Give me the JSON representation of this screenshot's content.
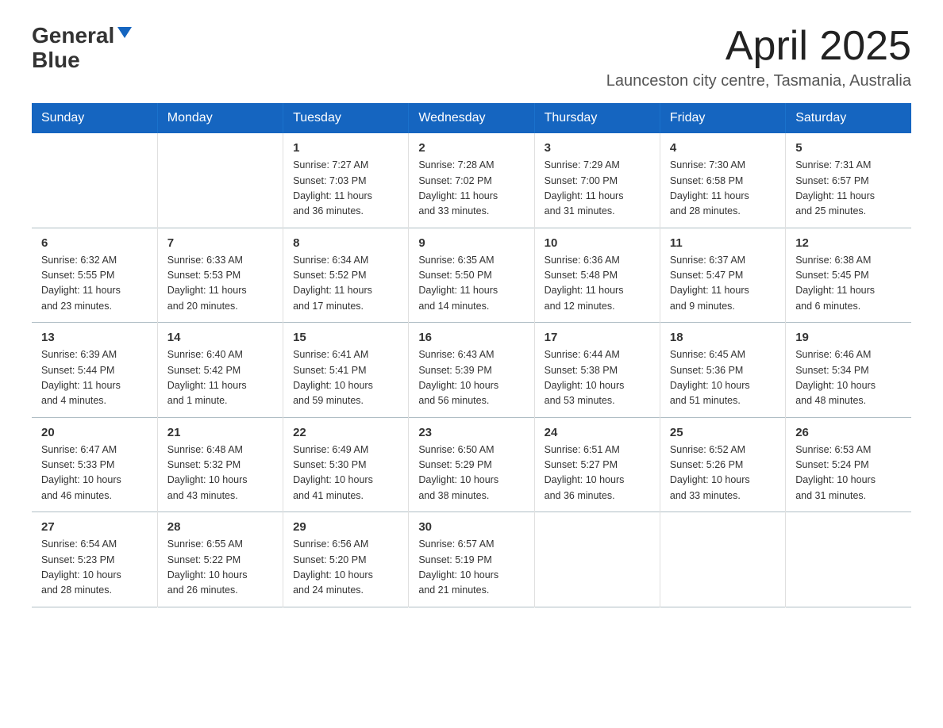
{
  "header": {
    "logo_line1": "General",
    "logo_line2": "Blue",
    "month_title": "April 2025",
    "location": "Launceston city centre, Tasmania, Australia"
  },
  "weekdays": [
    "Sunday",
    "Monday",
    "Tuesday",
    "Wednesday",
    "Thursday",
    "Friday",
    "Saturday"
  ],
  "weeks": [
    [
      {
        "day": "",
        "info": ""
      },
      {
        "day": "",
        "info": ""
      },
      {
        "day": "1",
        "info": "Sunrise: 7:27 AM\nSunset: 7:03 PM\nDaylight: 11 hours\nand 36 minutes."
      },
      {
        "day": "2",
        "info": "Sunrise: 7:28 AM\nSunset: 7:02 PM\nDaylight: 11 hours\nand 33 minutes."
      },
      {
        "day": "3",
        "info": "Sunrise: 7:29 AM\nSunset: 7:00 PM\nDaylight: 11 hours\nand 31 minutes."
      },
      {
        "day": "4",
        "info": "Sunrise: 7:30 AM\nSunset: 6:58 PM\nDaylight: 11 hours\nand 28 minutes."
      },
      {
        "day": "5",
        "info": "Sunrise: 7:31 AM\nSunset: 6:57 PM\nDaylight: 11 hours\nand 25 minutes."
      }
    ],
    [
      {
        "day": "6",
        "info": "Sunrise: 6:32 AM\nSunset: 5:55 PM\nDaylight: 11 hours\nand 23 minutes."
      },
      {
        "day": "7",
        "info": "Sunrise: 6:33 AM\nSunset: 5:53 PM\nDaylight: 11 hours\nand 20 minutes."
      },
      {
        "day": "8",
        "info": "Sunrise: 6:34 AM\nSunset: 5:52 PM\nDaylight: 11 hours\nand 17 minutes."
      },
      {
        "day": "9",
        "info": "Sunrise: 6:35 AM\nSunset: 5:50 PM\nDaylight: 11 hours\nand 14 minutes."
      },
      {
        "day": "10",
        "info": "Sunrise: 6:36 AM\nSunset: 5:48 PM\nDaylight: 11 hours\nand 12 minutes."
      },
      {
        "day": "11",
        "info": "Sunrise: 6:37 AM\nSunset: 5:47 PM\nDaylight: 11 hours\nand 9 minutes."
      },
      {
        "day": "12",
        "info": "Sunrise: 6:38 AM\nSunset: 5:45 PM\nDaylight: 11 hours\nand 6 minutes."
      }
    ],
    [
      {
        "day": "13",
        "info": "Sunrise: 6:39 AM\nSunset: 5:44 PM\nDaylight: 11 hours\nand 4 minutes."
      },
      {
        "day": "14",
        "info": "Sunrise: 6:40 AM\nSunset: 5:42 PM\nDaylight: 11 hours\nand 1 minute."
      },
      {
        "day": "15",
        "info": "Sunrise: 6:41 AM\nSunset: 5:41 PM\nDaylight: 10 hours\nand 59 minutes."
      },
      {
        "day": "16",
        "info": "Sunrise: 6:43 AM\nSunset: 5:39 PM\nDaylight: 10 hours\nand 56 minutes."
      },
      {
        "day": "17",
        "info": "Sunrise: 6:44 AM\nSunset: 5:38 PM\nDaylight: 10 hours\nand 53 minutes."
      },
      {
        "day": "18",
        "info": "Sunrise: 6:45 AM\nSunset: 5:36 PM\nDaylight: 10 hours\nand 51 minutes."
      },
      {
        "day": "19",
        "info": "Sunrise: 6:46 AM\nSunset: 5:34 PM\nDaylight: 10 hours\nand 48 minutes."
      }
    ],
    [
      {
        "day": "20",
        "info": "Sunrise: 6:47 AM\nSunset: 5:33 PM\nDaylight: 10 hours\nand 46 minutes."
      },
      {
        "day": "21",
        "info": "Sunrise: 6:48 AM\nSunset: 5:32 PM\nDaylight: 10 hours\nand 43 minutes."
      },
      {
        "day": "22",
        "info": "Sunrise: 6:49 AM\nSunset: 5:30 PM\nDaylight: 10 hours\nand 41 minutes."
      },
      {
        "day": "23",
        "info": "Sunrise: 6:50 AM\nSunset: 5:29 PM\nDaylight: 10 hours\nand 38 minutes."
      },
      {
        "day": "24",
        "info": "Sunrise: 6:51 AM\nSunset: 5:27 PM\nDaylight: 10 hours\nand 36 minutes."
      },
      {
        "day": "25",
        "info": "Sunrise: 6:52 AM\nSunset: 5:26 PM\nDaylight: 10 hours\nand 33 minutes."
      },
      {
        "day": "26",
        "info": "Sunrise: 6:53 AM\nSunset: 5:24 PM\nDaylight: 10 hours\nand 31 minutes."
      }
    ],
    [
      {
        "day": "27",
        "info": "Sunrise: 6:54 AM\nSunset: 5:23 PM\nDaylight: 10 hours\nand 28 minutes."
      },
      {
        "day": "28",
        "info": "Sunrise: 6:55 AM\nSunset: 5:22 PM\nDaylight: 10 hours\nand 26 minutes."
      },
      {
        "day": "29",
        "info": "Sunrise: 6:56 AM\nSunset: 5:20 PM\nDaylight: 10 hours\nand 24 minutes."
      },
      {
        "day": "30",
        "info": "Sunrise: 6:57 AM\nSunset: 5:19 PM\nDaylight: 10 hours\nand 21 minutes."
      },
      {
        "day": "",
        "info": ""
      },
      {
        "day": "",
        "info": ""
      },
      {
        "day": "",
        "info": ""
      }
    ]
  ]
}
